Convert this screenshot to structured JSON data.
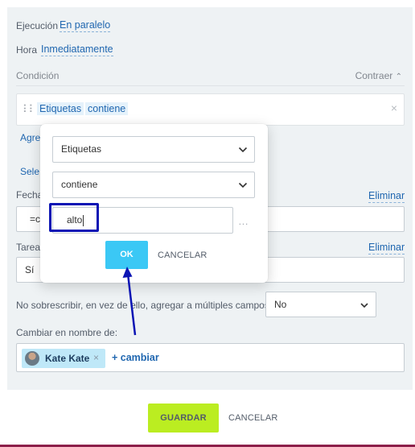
{
  "form": {
    "execution_label": "Ejecución",
    "execution_value": "En paralelo",
    "time_label": "Hora",
    "time_value": "Inmediatamente",
    "condition_label": "Condición",
    "collapse_label": "Contraer",
    "condition_field": "Etiquetas",
    "condition_operator": "contiene",
    "hidden_add_link": "Agre",
    "hidden_select_link": "Sele",
    "date_label": "Fecha",
    "date_value": "=c",
    "remove_label_1": "Eliminar",
    "task_label": "Tarea",
    "task_value": "Sí",
    "remove_label_2": "Eliminar",
    "overwrite_label": "No sobrescribir, en vez de ello, agregar a múltiples campos:",
    "overwrite_value": "No",
    "change_author_label": "Cambiar en nombre de:",
    "person_name": "Kate Kate",
    "add_change_label": "+ cambiar"
  },
  "popup": {
    "field_select": "Etiquetas",
    "operator_select": "contiene",
    "value_input": "alto",
    "ok_label": "OK",
    "cancel_label": "CANCELAR"
  },
  "footer": {
    "save_label": "GUARDAR",
    "cancel_label": "CANCELAR"
  },
  "colors": {
    "accent_link": "#2067b0",
    "ok_button": "#3bc8f5",
    "save_button": "#bbed21",
    "annotation": "#0b14b4"
  }
}
